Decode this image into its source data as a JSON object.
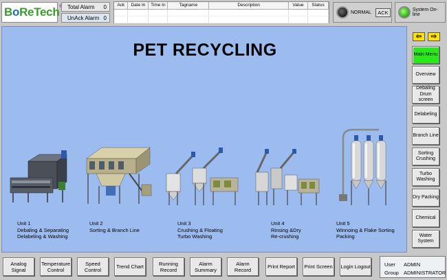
{
  "logo": {
    "text_b": "B",
    "text_o": "o",
    "text_re": "ReTech",
    "reg": "®"
  },
  "alarms": {
    "total_label": "Total Alarm",
    "total_value": "0",
    "unack_label": "UnAck Alarm",
    "unack_value": "0"
  },
  "alarm_table": {
    "columns": [
      "Ack",
      "Date In",
      "Time In",
      "Tagname",
      "Description",
      "Value",
      "Status"
    ]
  },
  "status": {
    "normal_label": "NORMAL",
    "ack_label": "ACK",
    "online_label": "System On-line"
  },
  "page_title": "PET RECYCLING",
  "units": [
    {
      "line1": "Unit 1",
      "line2": "Debaling & Separating",
      "line3": "Delabeling & Washing"
    },
    {
      "line1": "Unit 2",
      "line2": "Sorting & Branch Line",
      "line3": ""
    },
    {
      "line1": "Unit 3",
      "line2": "Crushing & Floating",
      "line3": "Turbo Washing"
    },
    {
      "line1": "Unit 4",
      "line2": "Rinsing &Dry",
      "line3": "Re-crushing"
    },
    {
      "line1": "Unit 5",
      "line2": "Winnoing & Flake Sorting",
      "line3": "Packing"
    }
  ],
  "sidebar": {
    "arrow_left": "⇦",
    "arrow_right": "⇨",
    "items": [
      {
        "label": "Main Menu"
      },
      {
        "label": "Overview"
      },
      {
        "label": "Debaling Drum screen"
      },
      {
        "label": "Delabeling"
      },
      {
        "label": "Branch Line"
      },
      {
        "label": "Sorting Crushing"
      },
      {
        "label": "Turbo Washing"
      },
      {
        "label": "Dry Packing"
      },
      {
        "label": "Chemical"
      },
      {
        "label": "Water System"
      }
    ]
  },
  "bottom": {
    "buttons": [
      {
        "label": "Analog Signal"
      },
      {
        "label": "Temperature Control"
      },
      {
        "label": "Speed Control"
      },
      {
        "label": "Trend Chart"
      },
      {
        "label": "Running Record"
      },
      {
        "label": "Alarm Summary"
      },
      {
        "label": "Alarm Record"
      },
      {
        "label": "Print Report"
      },
      {
        "label": "Print Screen"
      },
      {
        "label": "Login Logout"
      }
    ]
  },
  "user": {
    "user_label": "User",
    "user_value": "ADMIN",
    "group_label": "Group",
    "group_value": "ADMINISTRATOR"
  },
  "colors": {
    "main_bg": "#9cbcf0",
    "active_btn": "#29e81b",
    "online": "#2faa10",
    "arrow": "#ffe200"
  }
}
